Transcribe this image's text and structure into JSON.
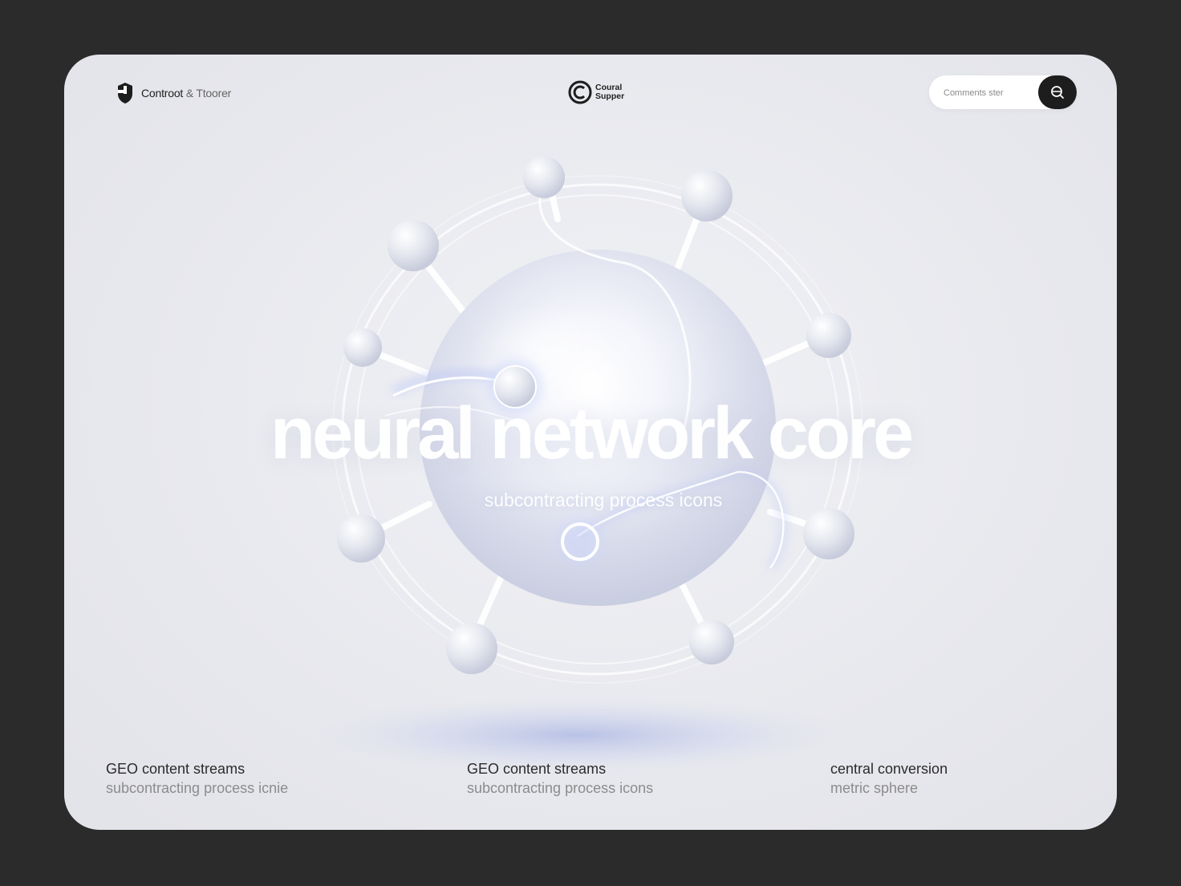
{
  "header": {
    "brand_primary": "Controot",
    "brand_secondary": "& Ttoorer",
    "brand_icon": "puzzle-shield-icon",
    "center_logo_icon": "c-circle-logo-icon",
    "center_logo_line1": "Coural",
    "center_logo_line2": "Supper",
    "search": {
      "placeholder": "Comments ster",
      "button_icon": "search-icon"
    }
  },
  "hero": {
    "title": "neural network core",
    "subtitle": "subcontracting process icons"
  },
  "features": [
    {
      "title": "GEO content streams",
      "desc": "subcontracting process icnie"
    },
    {
      "title": "GEO content streams",
      "desc": "subcontracting process icons"
    },
    {
      "title": "central conversion",
      "desc": "metric sphere"
    }
  ],
  "colors": {
    "page_bg": "#2b2b2b",
    "card_bg": "#e8e9ee",
    "accent": "#8aa0e8",
    "search_button": "#1d1d1d"
  }
}
